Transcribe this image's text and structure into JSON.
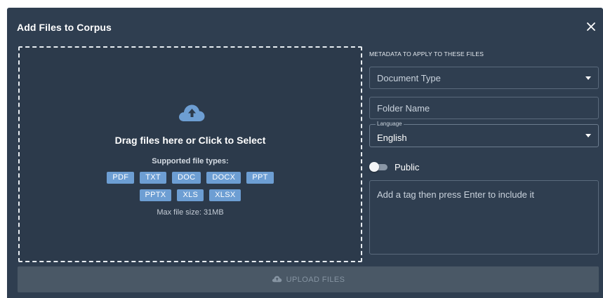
{
  "dialog": {
    "title": "Add Files to Corpus",
    "close_icon": "close-icon"
  },
  "dropzone": {
    "icon": "cloud-upload-icon",
    "title": "Drag files here or Click to Select",
    "supported_label": "Supported file types:",
    "file_types_row1": [
      "PDF",
      "TXT",
      "DOC",
      "DOCX",
      "PPT"
    ],
    "file_types_row2": [
      "PPTX",
      "XLS",
      "XLSX"
    ],
    "max_size": "Max file size: 31MB"
  },
  "metadata": {
    "section_label": "METADATA TO APPLY TO THESE FILES",
    "document_type_placeholder": "Document Type",
    "folder_name_placeholder": "Folder Name",
    "language_label": "Language",
    "language_value": "English",
    "public_label": "Public",
    "public_enabled": false,
    "tags_placeholder": "Add a tag then press Enter to include it"
  },
  "footer": {
    "upload_label": "UPLOAD FILES",
    "upload_icon": "cloud-upload-icon",
    "upload_enabled": false
  },
  "colors": {
    "dialog_bg": "#2f3e50",
    "chip_bg": "#6d9ed3",
    "button_disabled_bg": "#4a5866"
  }
}
